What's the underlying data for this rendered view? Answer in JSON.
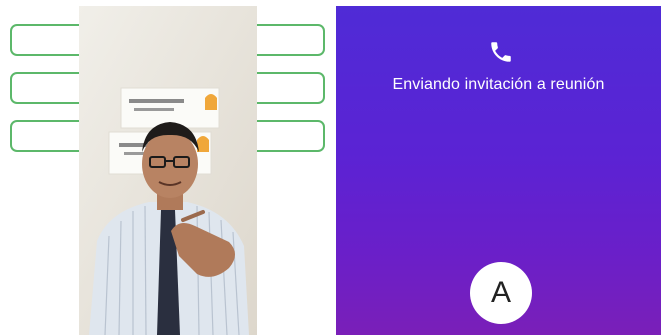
{
  "call": {
    "status_text": "Enviando invitación a reunión",
    "avatar_initial": "A",
    "icon": "phone-icon"
  },
  "colors": {
    "gradient_top": "#4f2bd6",
    "gradient_bottom": "#7a1fb8",
    "outline_green": "#5cb86a"
  }
}
